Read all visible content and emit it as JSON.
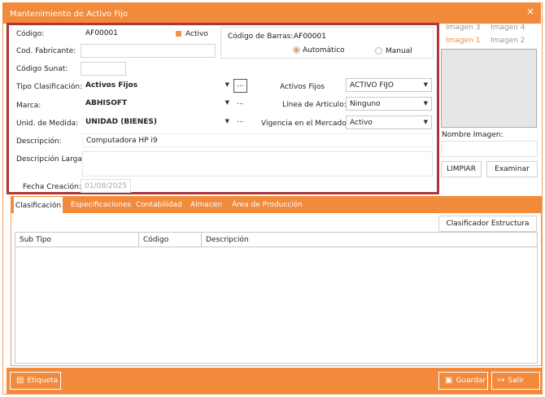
{
  "window": {
    "title": "Mantenimiento de Activo Fijo",
    "close_glyph": "×"
  },
  "form": {
    "codigo": {
      "label": "Código:",
      "value": "AF00001"
    },
    "activo_label": "Activo",
    "cod_fabricante": {
      "label": "Cod. Fabricante:",
      "value": ""
    },
    "codigo_sunat": {
      "label": "Código Sunat:",
      "value": ""
    },
    "codigo_barras": {
      "label": "Código de Barras:",
      "value": "AF00001"
    },
    "barcode_mode": {
      "auto": "Automático",
      "manual": "Manual",
      "selected": "Automático"
    },
    "tipo_clasificacion": {
      "label": "Tipo Clasificación:",
      "value": "Activos Fijos"
    },
    "marca": {
      "label": "Marca:",
      "value": "ABHISOFT"
    },
    "unidad_medida": {
      "label": "Unid. de Medida:",
      "value": "UNIDAD (BIENES)"
    },
    "descripcion": {
      "label": "Descripción:",
      "value": "Computadora HP i9"
    },
    "descripcion_larga": {
      "label": "Descripción Larga:",
      "value": ""
    },
    "fecha_creacion": {
      "label": "Fecha Creación:",
      "value": "01/08/2025"
    },
    "activos_fijos": {
      "label": "Activos Fijos",
      "value": "ACTIVO FIJO"
    },
    "linea_articulo": {
      "label": "Línea de Articulo:",
      "value": "Ninguno"
    },
    "vigencia_mercado": {
      "label": "Vigencia en el Mercado:",
      "value": "Activo"
    },
    "dots_label": "..."
  },
  "images": {
    "tabs": [
      "Imagen 3",
      "Imagen 4",
      "Imagen 1",
      "Imagen 2"
    ],
    "active_tab": "Imagen 1",
    "nombre_label": "Nombre Imagen:",
    "nombre_value": "",
    "limpiar_label": "LIMPIAR",
    "examinar_label": "Examinar"
  },
  "tabs": [
    "Clasificación",
    "Especificaciones",
    "Contabilidad",
    "Almacen",
    "Área de Producción"
  ],
  "active_tab": "Clasificación",
  "clasificacion": {
    "button_label": "Clasificador Estructura",
    "columns": [
      "Sub Tipo",
      "Código",
      "Descripción"
    ]
  },
  "footer": {
    "etiqueta_label": "Etiqueta",
    "guardar_label": "Guardar",
    "salir_label": "Salir"
  },
  "colors": {
    "accent": "#f28a3c",
    "frame": "#b03438",
    "image_bg": "#e6e6e6"
  },
  "icons": [
    "close-icon",
    "checkbox-icon",
    "dropdown-arrow-icon",
    "label-icon",
    "save-icon",
    "exit-icon"
  ]
}
